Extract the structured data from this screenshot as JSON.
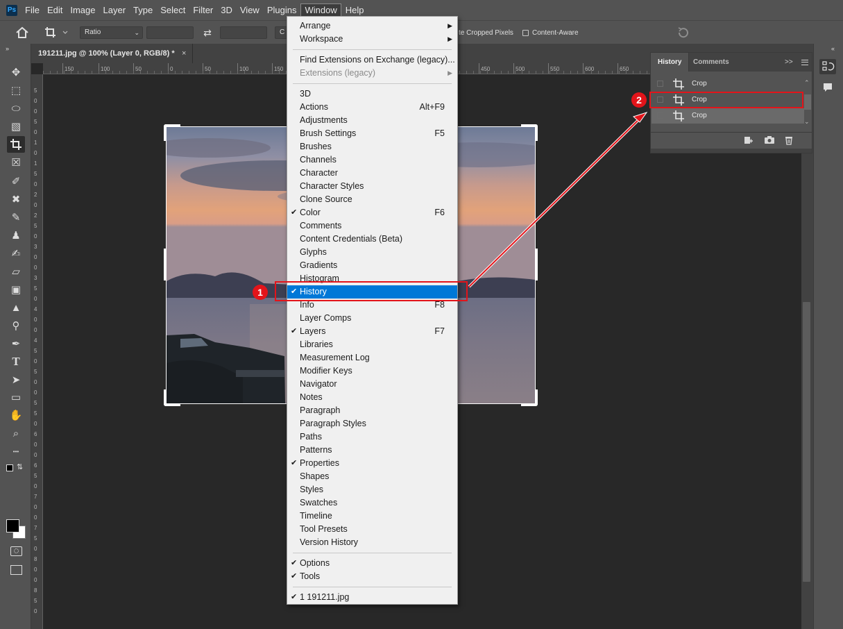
{
  "menubar": {
    "items": [
      "File",
      "Edit",
      "Image",
      "Layer",
      "Type",
      "Select",
      "Filter",
      "3D",
      "View",
      "Plugins",
      "Window",
      "Help"
    ],
    "active_index": 10,
    "logo": "Ps"
  },
  "options_bar": {
    "ratio": "Ratio",
    "delete_cropped_label": "te Cropped Pixels",
    "content_aware_label": "Content-Aware",
    "partial_field": "C"
  },
  "document": {
    "tab_title": "191211.jpg @ 100% (Layer 0, RGB/8) *",
    "close_glyph": "×"
  },
  "ruler": {
    "top_ticks": [
      "150",
      "100",
      "50",
      "0",
      "50",
      "100",
      "150",
      "450",
      "500",
      "550",
      "600",
      "650"
    ],
    "left_ticks": [
      "5",
      "0",
      "0",
      "5",
      "0",
      "1",
      "0",
      "1",
      "5",
      "0",
      "2",
      "0",
      "2",
      "5",
      "0",
      "3",
      "0",
      "0",
      "3",
      "5",
      "0",
      "4",
      "0",
      "0",
      "4",
      "5",
      "0",
      "5",
      "0",
      "0",
      "5",
      "5",
      "0",
      "6",
      "0",
      "0",
      "6",
      "5",
      "0",
      "7",
      "0",
      "0",
      "7",
      "5",
      "0",
      "8",
      "0",
      "0",
      "8",
      "5",
      "0"
    ]
  },
  "history_panel": {
    "tab_history": "History",
    "tab_comments": "Comments",
    "expand": ">>",
    "rows": [
      {
        "label": "Crop"
      },
      {
        "label": "Crop"
      },
      {
        "label": "Crop"
      }
    ]
  },
  "window_menu": {
    "sections": [
      [
        {
          "label": "Arrange",
          "submenu": true
        },
        {
          "label": "Workspace",
          "submenu": true
        }
      ],
      [
        {
          "label": "Find Extensions on Exchange (legacy)..."
        },
        {
          "label": "Extensions (legacy)",
          "submenu": true,
          "disabled": true
        }
      ],
      [
        {
          "label": "3D"
        },
        {
          "label": "Actions",
          "shortcut": "Alt+F9"
        },
        {
          "label": "Adjustments"
        },
        {
          "label": "Brush Settings",
          "shortcut": "F5"
        },
        {
          "label": "Brushes"
        },
        {
          "label": "Channels"
        },
        {
          "label": "Character"
        },
        {
          "label": "Character Styles"
        },
        {
          "label": "Clone Source"
        },
        {
          "label": "Color",
          "shortcut": "F6",
          "checked": true
        },
        {
          "label": "Comments"
        },
        {
          "label": "Content Credentials (Beta)"
        },
        {
          "label": "Glyphs"
        },
        {
          "label": "Gradients"
        },
        {
          "label": "Histogram"
        },
        {
          "label": "History",
          "checked": true,
          "highlighted": true
        },
        {
          "label": "Info",
          "shortcut": "F8"
        },
        {
          "label": "Layer Comps"
        },
        {
          "label": "Layers",
          "shortcut": "F7",
          "checked": true
        },
        {
          "label": "Libraries"
        },
        {
          "label": "Measurement Log"
        },
        {
          "label": "Modifier Keys"
        },
        {
          "label": "Navigator"
        },
        {
          "label": "Notes"
        },
        {
          "label": "Paragraph"
        },
        {
          "label": "Paragraph Styles"
        },
        {
          "label": "Paths"
        },
        {
          "label": "Patterns"
        },
        {
          "label": "Properties",
          "checked": true
        },
        {
          "label": "Shapes"
        },
        {
          "label": "Styles"
        },
        {
          "label": "Swatches"
        },
        {
          "label": "Timeline"
        },
        {
          "label": "Tool Presets"
        },
        {
          "label": "Version History"
        }
      ],
      [
        {
          "label": "Options",
          "checked": true
        },
        {
          "label": "Tools",
          "checked": true
        }
      ],
      [
        {
          "label": "1 191211.jpg",
          "checked": true
        }
      ]
    ]
  },
  "annotations": {
    "badge1": "1",
    "badge2": "2"
  },
  "colors": {
    "accent": "#0078d7",
    "annotation_red": "#e3141a",
    "ui_dark": "#535353",
    "canvas": "#282828"
  },
  "tools": [
    "move-icon",
    "marquee-icon",
    "lasso-icon",
    "object-select-icon",
    "crop-icon",
    "frame-icon",
    "eyedropper-icon",
    "healing-icon",
    "brush-icon",
    "stamp-icon",
    "history-brush-icon",
    "eraser-icon",
    "gradient-icon",
    "blur-icon",
    "dodge-icon",
    "pen-icon",
    "type-icon",
    "path-select-icon",
    "rectangle-icon",
    "hand-icon",
    "zoom-icon",
    "more-icon"
  ]
}
